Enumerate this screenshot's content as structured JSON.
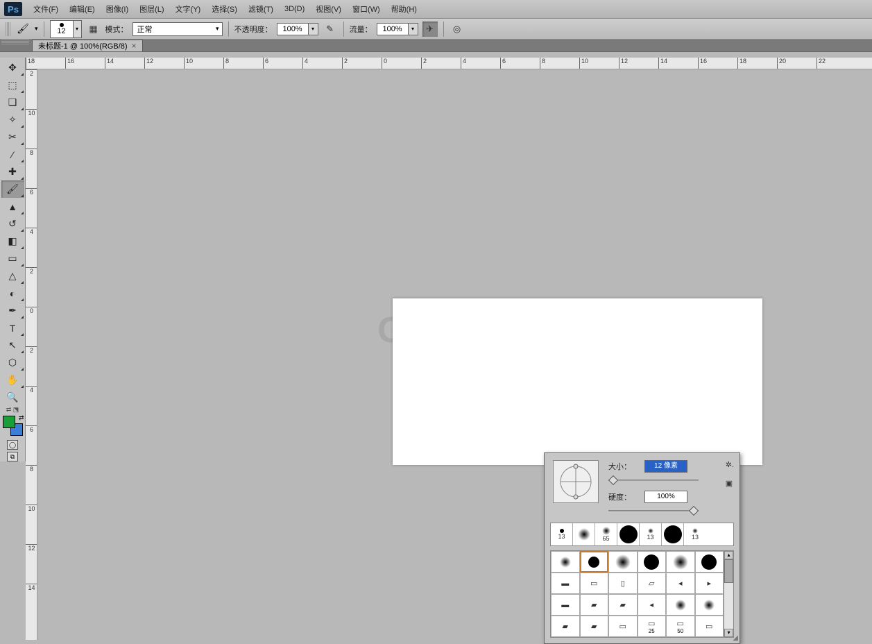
{
  "app": {
    "logo": "Ps"
  },
  "menu": [
    "文件(F)",
    "编辑(E)",
    "图像(I)",
    "图层(L)",
    "文字(Y)",
    "选择(S)",
    "滤镜(T)",
    "3D(D)",
    "视图(V)",
    "窗口(W)",
    "帮助(H)"
  ],
  "options": {
    "brush_size": "12",
    "mode_label": "模式：",
    "mode_value": "正常",
    "opacity_label": "不透明度：",
    "opacity_value": "100%",
    "flow_label": "流量：",
    "flow_value": "100%"
  },
  "doc_tab": {
    "title": "未标题-1 @ 100%(RGB/8)",
    "close": "×"
  },
  "ruler_h": [
    "18",
    "16",
    "14",
    "12",
    "10",
    "8",
    "6",
    "4",
    "2",
    "0",
    "2",
    "4",
    "6",
    "8",
    "10",
    "12",
    "14",
    "16",
    "18",
    "20",
    "22"
  ],
  "ruler_v": [
    "2",
    "10",
    "8",
    "6",
    "4",
    "2",
    "0",
    "2",
    "4",
    "6",
    "8",
    "10",
    "12",
    "14"
  ],
  "watermark": "GXIT",
  "brush_popup": {
    "size_label": "大小：",
    "size_value": "12 像素",
    "hardness_label": "硬度：",
    "hardness_value": "100%",
    "preset_top": [
      {
        "size": "13",
        "d": 6,
        "blur": false
      },
      {
        "size": "",
        "d": 18,
        "blur": true
      },
      {
        "size": "65",
        "d": 12,
        "blur": true
      },
      {
        "size": "",
        "d": 26,
        "blur": false
      },
      {
        "size": "13",
        "d": 8,
        "blur": true
      },
      {
        "size": "",
        "d": 26,
        "blur": false
      },
      {
        "size": "13",
        "d": 8,
        "blur": true
      }
    ],
    "grid_labels": {
      "25": "25",
      "50": "50"
    }
  }
}
